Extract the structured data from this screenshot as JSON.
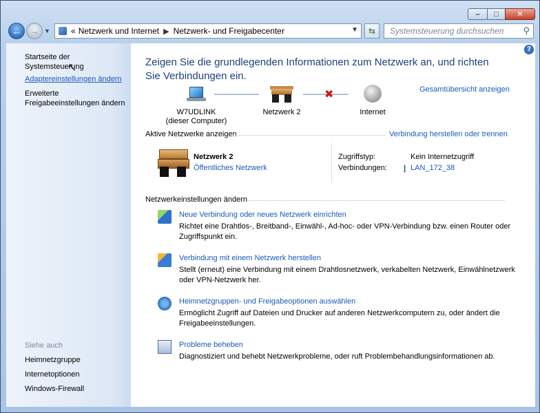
{
  "window": {
    "caption_min": "–",
    "caption_max": "□",
    "caption_close": "✕"
  },
  "nav": {
    "breadcrumb_root": "«",
    "breadcrumb": [
      "Netzwerk und Internet",
      "Netzwerk- und Freigabecenter"
    ],
    "search_placeholder": "Systemsteuerung durchsuchen"
  },
  "sidebar": {
    "home": "Startseite der Systemsteuerung",
    "adapter": "Adaptereinstellungen ändern",
    "advanced_line1": "Erweiterte",
    "advanced_line2": "Freigabeeinstellungen ändern",
    "see_also": "Siehe auch",
    "see_also_items": [
      "Heimnetzgruppe",
      "Internetoptionen",
      "Windows-Firewall"
    ]
  },
  "main": {
    "title": "Zeigen Sie die grundlegenden Informationen zum Netzwerk an, und richten Sie Verbindungen ein.",
    "map_link": "Gesamtübersicht anzeigen",
    "nodes": {
      "computer_line1": "W7UDLINK",
      "computer_line2": "(dieser Computer)",
      "network": "Netzwerk  2",
      "internet": "Internet"
    },
    "active_header": "Aktive Netzwerke anzeigen",
    "connect_link": "Verbindung herstellen oder trennen",
    "active": {
      "name": "Netzwerk  2",
      "type": "Öffentliches Netzwerk",
      "access_label": "Zugriffstyp:",
      "access_value": "Kein Internetzugriff",
      "conn_label": "Verbindungen:",
      "conn_value": "LAN_172_38"
    },
    "settings_header": "Netzwerkeinstellungen ändern",
    "tasks": [
      {
        "link": "Neue Verbindung oder neues Netzwerk einrichten",
        "desc": "Richtet eine Drahtlos-, Breitband-, Einwähl-, Ad-hoc- oder VPN-Verbindung bzw. einen Router oder Zugriffspunkt ein."
      },
      {
        "link": "Verbindung mit einem Netzwerk herstellen",
        "desc": "Stellt (erneut) eine Verbindung mit einem Drahtlosnetzwerk, verkabelten Netzwerk, Einwählnetzwerk oder VPN-Netzwerk her."
      },
      {
        "link": "Heimnetzgruppen- und Freigabeoptionen auswählen",
        "desc": "Ermöglicht Zugriff auf Dateien und Drucker auf anderen Netzwerkcomputern zu, oder ändert die Freigabeeinstellungen."
      },
      {
        "link": "Probleme beheben",
        "desc": "Diagnostiziert und behebt Netzwerkprobleme, oder ruft Problembehandlungsinformationen ab."
      }
    ]
  },
  "colors": {
    "link": "#1a5ab8",
    "title": "#1e3f7a",
    "error_x": "#d01818"
  }
}
